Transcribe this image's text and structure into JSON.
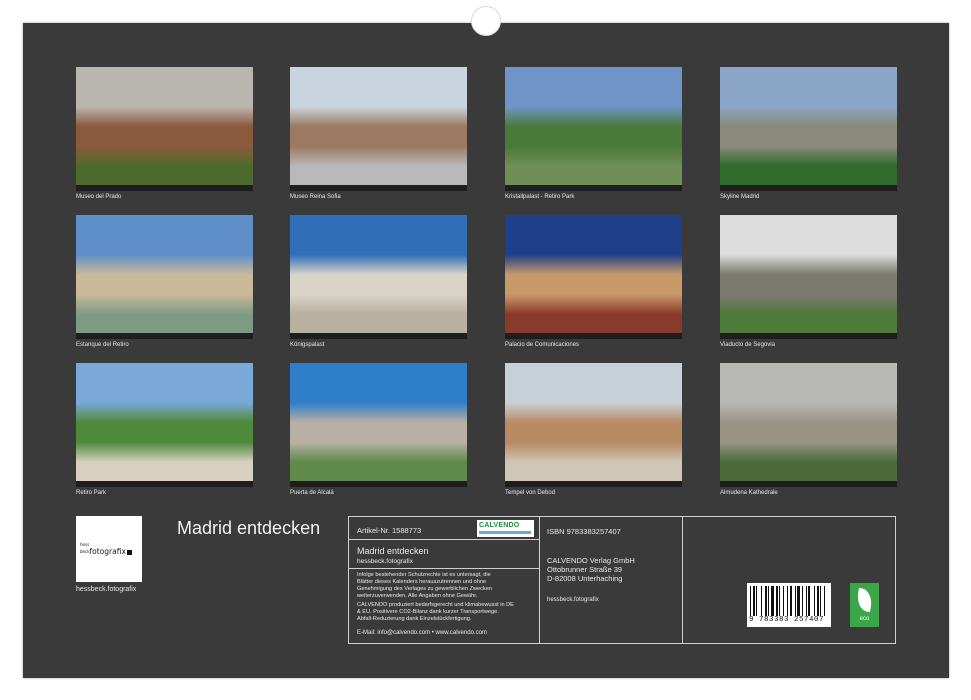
{
  "calendar": {
    "title": "Madrid entdecken",
    "photos": [
      {
        "caption": "Museo del Prado",
        "colors": [
          "#b9b6b0",
          "#8a5a3c",
          "#4d6a2c"
        ]
      },
      {
        "caption": "Museo Reina Sofia",
        "colors": [
          "#c9d4df",
          "#9a7a62",
          "#b9b9b9"
        ]
      },
      {
        "caption": "Kristallpalast - Retiro Park",
        "colors": [
          "#6f95c8",
          "#4a7a3a",
          "#6f8f56"
        ]
      },
      {
        "caption": "Skyline Madrid",
        "colors": [
          "#8ba6c6",
          "#8a8a7a",
          "#2f6b2a"
        ]
      },
      {
        "caption": "Estanque del Retiro",
        "colors": [
          "#5f8fc8",
          "#c9b89a",
          "#7f9a84"
        ]
      },
      {
        "caption": "Königspalast",
        "colors": [
          "#2f6fb8",
          "#d8d4c8",
          "#b8b0a0"
        ]
      },
      {
        "caption": "Palacio de Comunicaciones",
        "colors": [
          "#1e3f8a",
          "#c89a6a",
          "#8a3a2a"
        ]
      },
      {
        "caption": "Viaducto de Segovia",
        "colors": [
          "#dcdcdc",
          "#7a7a6e",
          "#4e7a3a"
        ]
      },
      {
        "caption": "Retiro Park",
        "colors": [
          "#7aa8d8",
          "#4f8a3a",
          "#d8d0c0"
        ]
      },
      {
        "caption": "Puerta de Alcalá",
        "colors": [
          "#2f7fc8",
          "#b8b0a4",
          "#5f8a4a"
        ]
      },
      {
        "caption": "Tempel von Debod",
        "colors": [
          "#c8d0d8",
          "#b88a62",
          "#cfc6b6"
        ]
      },
      {
        "caption": "Almudena Kathedrale",
        "colors": [
          "#b8b8b4",
          "#9a9484",
          "#4a6a3a"
        ]
      }
    ]
  },
  "publisher": {
    "logo_line1_small": "hess",
    "logo_line2_small": "beck",
    "logo_word": "fotografix",
    "logo_caption": "hessbeck.fotografix"
  },
  "info": {
    "article_label": "Artikel-Nr. 1588773",
    "calvendo_logo": "CALVENDO",
    "product_title": "Madrid entdecken",
    "author": "hessbeck.fotografix",
    "copyright_text": [
      "Infolge bestehender Schutzrechte ist es untersagt, die",
      "Blätter dieses Kalenders herauszutrennen und ohne",
      "Genehmigung des Verlages zu gewerblichen Zwecken",
      "weiterzuverwenden. Alle Angaben ohne Gewähr."
    ],
    "climate_text": [
      "CALVENDO produziert bedarfsgerecht und klimabewusst in DE",
      "& EU. Positivere CO2-Bilanz dank kurzer Transportwege.",
      "Abfall-Reduzierung dank Einzelstückfertigung."
    ],
    "contact": "E-Mail: info@calvendo.com • www.calvendo.com",
    "isbn": "ISBN 9783383257407",
    "publisher_name": "CALVENDO Verlag GmbH",
    "street": "Ottobrunner Straße 39",
    "city": "D-82008 Unterhaching",
    "author2": "hessbeck.fotografix",
    "barcode_number": "9 783383 257407",
    "eco_label": "eco"
  }
}
